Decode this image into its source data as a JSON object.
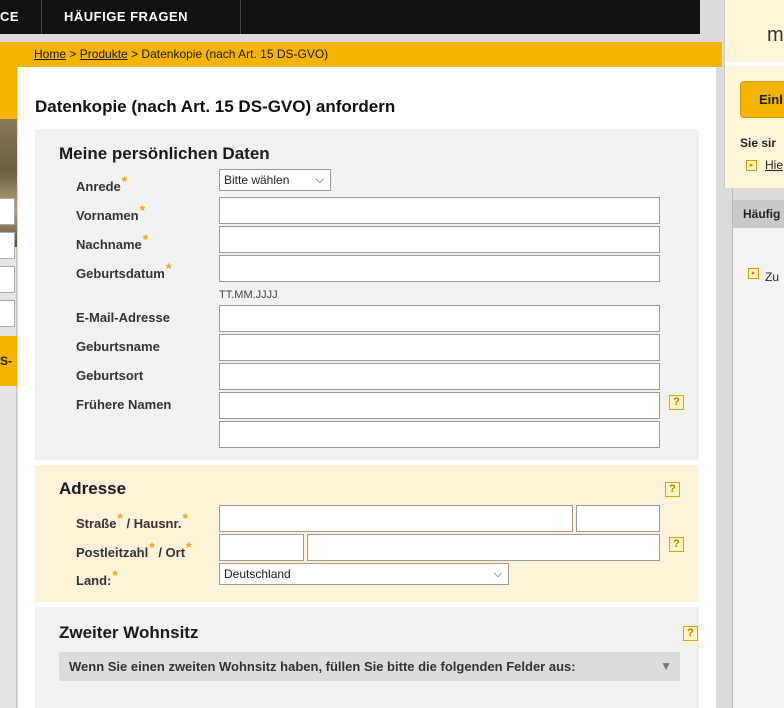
{
  "nav": {
    "tab_partial": "CE",
    "tab_faq": "HÄUFIGE FRAGEN"
  },
  "breadcrumb": {
    "home": "Home",
    "sep1": " > ",
    "products": "Produkte",
    "sep2": " > ",
    "current": "Datenkopie (nach Art. 15 DS-GVO)"
  },
  "page": {
    "title": "Datenkopie (nach Art. 15 DS-GVO) anfordern"
  },
  "personal": {
    "title": "Meine persönlichen Daten",
    "salutation_label": "Anrede",
    "salutation_value": "Bitte wählen",
    "firstname_label": "Vornamen",
    "lastname_label": "Nachname",
    "birthdate_label": "Geburtsdatum",
    "birthdate_hint": "TT.MM.JJJJ",
    "email_label": "E-Mail-Adresse",
    "birthname_label": "Geburtsname",
    "birthplace_label": "Geburtsort",
    "former_names_label": "Frühere Namen"
  },
  "address": {
    "title": "Adresse",
    "street_label": "Straße",
    "housenr_label": " / Hausnr.",
    "zip_label": "Postleitzahl",
    "city_label": " / Ort",
    "country_label": "Land:",
    "country_value": "Deutschland"
  },
  "second": {
    "title": "Zweiter Wohnsitz",
    "note": "Wenn Sie einen zweiten Wohnsitz haben, füllen Sie bitte die folgenden Felder aus:"
  },
  "left_sidebar": {
    "partial": "S-"
  },
  "right_sidebar": {
    "logo_partial": "m",
    "button_partial": "Einl",
    "text_partial": "Sie sir",
    "link_partial": "Hie",
    "faq_partial": "Häufig",
    "item_partial": "Zu"
  },
  "icons": {
    "help": "?",
    "star": "*",
    "chevron": "⌵",
    "dropdown_arrow": "▼",
    "bullet": "▸"
  },
  "colors": {
    "accent": "#f5b400",
    "nav_bg": "#111111",
    "address_bg": "#fdf3d9",
    "panel_bg": "#f1f1f1"
  }
}
